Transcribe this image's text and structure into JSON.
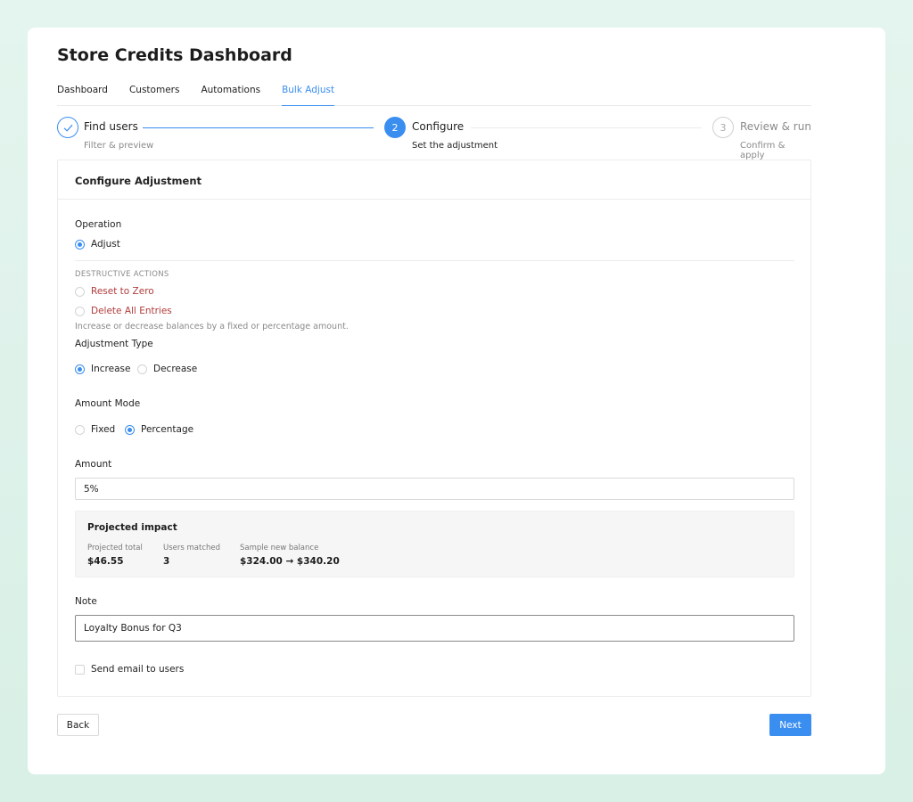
{
  "title": "Store Credits Dashboard",
  "tabs": [
    "Dashboard",
    "Customers",
    "Automations",
    "Bulk Adjust"
  ],
  "active_tab": "Bulk Adjust",
  "steps": [
    {
      "label": "Find users",
      "sub": "Filter & preview",
      "state": "done",
      "icon": "check-icon"
    },
    {
      "label": "Configure",
      "sub": "Set the adjustment",
      "state": "active",
      "number": "2"
    },
    {
      "label": "Review & run",
      "sub": "Confirm & apply",
      "state": "pending",
      "number": "3"
    }
  ],
  "panel": {
    "title": "Configure Adjustment",
    "operation_label": "Operation",
    "operation_selected": "Adjust",
    "destructive_heading": "DESTRUCTIVE ACTIONS",
    "destructive_options": [
      "Reset to Zero",
      "Delete All Entries"
    ],
    "operation_help": "Increase or decrease balances by a fixed or percentage amount.",
    "adjustment_type_label": "Adjustment Type",
    "adjustment_type_options": [
      "Increase",
      "Decrease"
    ],
    "adjustment_type_selected": "Increase",
    "amount_mode_label": "Amount Mode",
    "amount_mode_options": [
      "Fixed",
      "Percentage"
    ],
    "amount_mode_selected": "Percentage",
    "amount_label": "Amount",
    "amount_value": "5%",
    "impact": {
      "title": "Projected impact",
      "projected_total_label": "Projected total",
      "projected_total": "$46.55",
      "users_matched_label": "Users matched",
      "users_matched": "3",
      "sample_label": "Sample new balance",
      "sample_value": "$324.00 → $340.20"
    },
    "note_label": "Note",
    "note_value": "Loyalty Bonus for Q3",
    "send_email_label": "Send email to users",
    "send_email_checked": false
  },
  "buttons": {
    "back": "Back",
    "next": "Next"
  },
  "colors": {
    "accent": "#3a8ef0",
    "destructive": "#b23b3b"
  }
}
